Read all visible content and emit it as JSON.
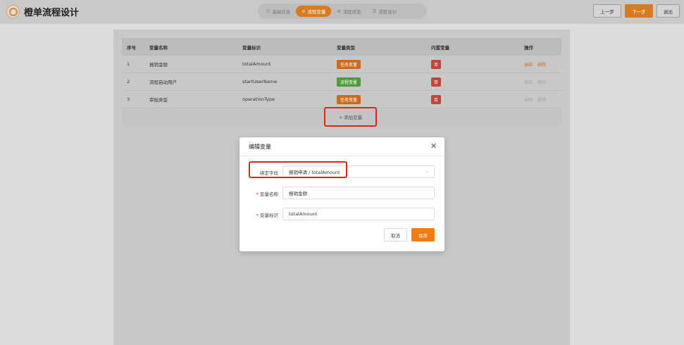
{
  "header": {
    "title": "橙单流程设计",
    "steps": [
      {
        "icon": "☷",
        "label": "基础信息"
      },
      {
        "icon": "⊙",
        "label": "流程变量"
      },
      {
        "icon": "⚙",
        "label": "流程状态"
      },
      {
        "icon": "☰",
        "label": "流程设计"
      }
    ],
    "prev_label": "上一步",
    "next_label": "下一步",
    "exit_label": "退出"
  },
  "table": {
    "columns": [
      "序号",
      "变量名称",
      "变量标识",
      "变量类型",
      "内置变量",
      "操作"
    ],
    "rows": [
      {
        "index": "1",
        "name": "报销金额",
        "key": "totalAmount",
        "type": "任务变量",
        "builtin": "否",
        "edit": "编辑",
        "delete": "删除"
      },
      {
        "index": "2",
        "name": "流程启动用户",
        "key": "startUserName",
        "type": "流程变量",
        "builtin": "否",
        "edit": "编辑",
        "delete": "删除"
      },
      {
        "index": "3",
        "name": "审批类型",
        "key": "operationType",
        "type": "任务变量",
        "builtin": "否",
        "edit": "编辑",
        "delete": "删除"
      }
    ],
    "add_label": "+ 添加变量"
  },
  "modal": {
    "title": "编辑变量",
    "bind_field_label": "绑定字段",
    "bind_field_value": "报销申请 / totalAmount",
    "name_label": "变量名称",
    "name_value": "报销金额",
    "key_label": "变量标识",
    "key_value": "totalAmount",
    "cancel_label": "取消",
    "save_label": "保存"
  }
}
